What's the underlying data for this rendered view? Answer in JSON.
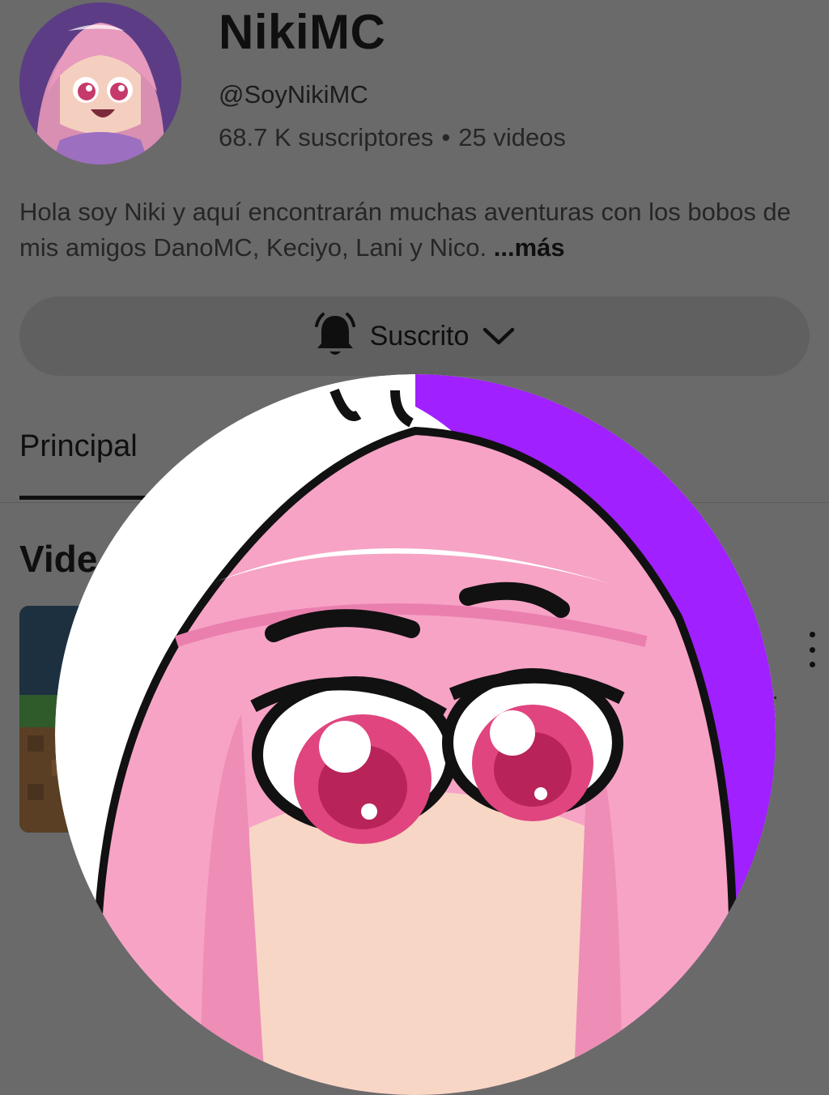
{
  "channel": {
    "name": "NikiMC",
    "handle": "@SoyNikiMC",
    "subscribers": "68.7 K suscriptores",
    "separator": "•",
    "videos": "25 videos"
  },
  "description": {
    "text": "Hola soy Niki y aquí encontrarán muchas aventuras con los bobos de mis amigos DanoMC, Keciyo, Lani y Nico. ",
    "more_label": "...más"
  },
  "subscribe": {
    "label": "Suscrito",
    "bell_icon": "bell-icon",
    "chevron_icon": "chevron-down-icon"
  },
  "tabs": [
    {
      "label": "Principal",
      "selected": true
    }
  ],
  "section": {
    "title": "Vide"
  },
  "video": {
    "menu_icon": "more-vert-icon",
    "meta_ellipsis": ".."
  },
  "overlay": {
    "image": "enlarged-channel-avatar"
  },
  "colors": {
    "dim_background": "#6a6a6a",
    "hair_pink": "#f7a3c6",
    "accent_purple": "#a020ff",
    "eye_pink": "#e0457f"
  }
}
